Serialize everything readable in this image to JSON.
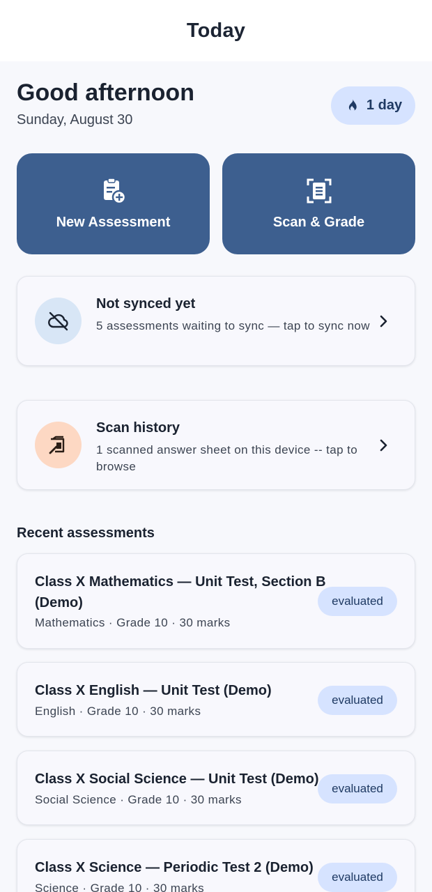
{
  "header": {
    "title": "Today"
  },
  "greeting": {
    "hello": "Good afternoon",
    "date": "Sunday, August 30"
  },
  "streak": {
    "label": "1 day",
    "icon": "flame-icon"
  },
  "actions": [
    {
      "label": "New Assessment",
      "icon": "clipboard-add-icon"
    },
    {
      "label": "Scan & Grade",
      "icon": "document-scan-icon"
    }
  ],
  "sync_card": {
    "title": "Not synced yet",
    "subtitle": "5 assessments waiting to sync — tap to sync now",
    "icon": "cloud-off-icon",
    "circle_color": "#d8e6f6"
  },
  "scan_card": {
    "title": "Scan history",
    "subtitle": "1 scanned answer sheet on this device -- tap to browse",
    "icon": "scan-history-icon",
    "circle_color": "#fdd8c3"
  },
  "recent": {
    "title": "Recent assessments",
    "items": [
      {
        "title": "Class X Mathematics — Unit Test, Section B (Demo)",
        "meta": "Mathematics · Grade 10 · 30 marks",
        "status": "evaluated"
      },
      {
        "title": "Class X English — Unit Test (Demo)",
        "meta": "English · Grade 10 · 30 marks",
        "status": "evaluated"
      },
      {
        "title": "Class X Social Science — Unit Test (Demo)",
        "meta": "Social Science · Grade 10 · 30 marks",
        "status": "evaluated"
      },
      {
        "title": "Class X Science — Periodic Test 2 (Demo)",
        "meta": "Science · Grade 10 · 30 marks",
        "status": "evaluated"
      }
    ]
  },
  "colors": {
    "primary": "#3d5f8f",
    "badge_bg": "#d6e3ff",
    "badge_text": "#1f3a63",
    "background": "#f7f8fc"
  }
}
